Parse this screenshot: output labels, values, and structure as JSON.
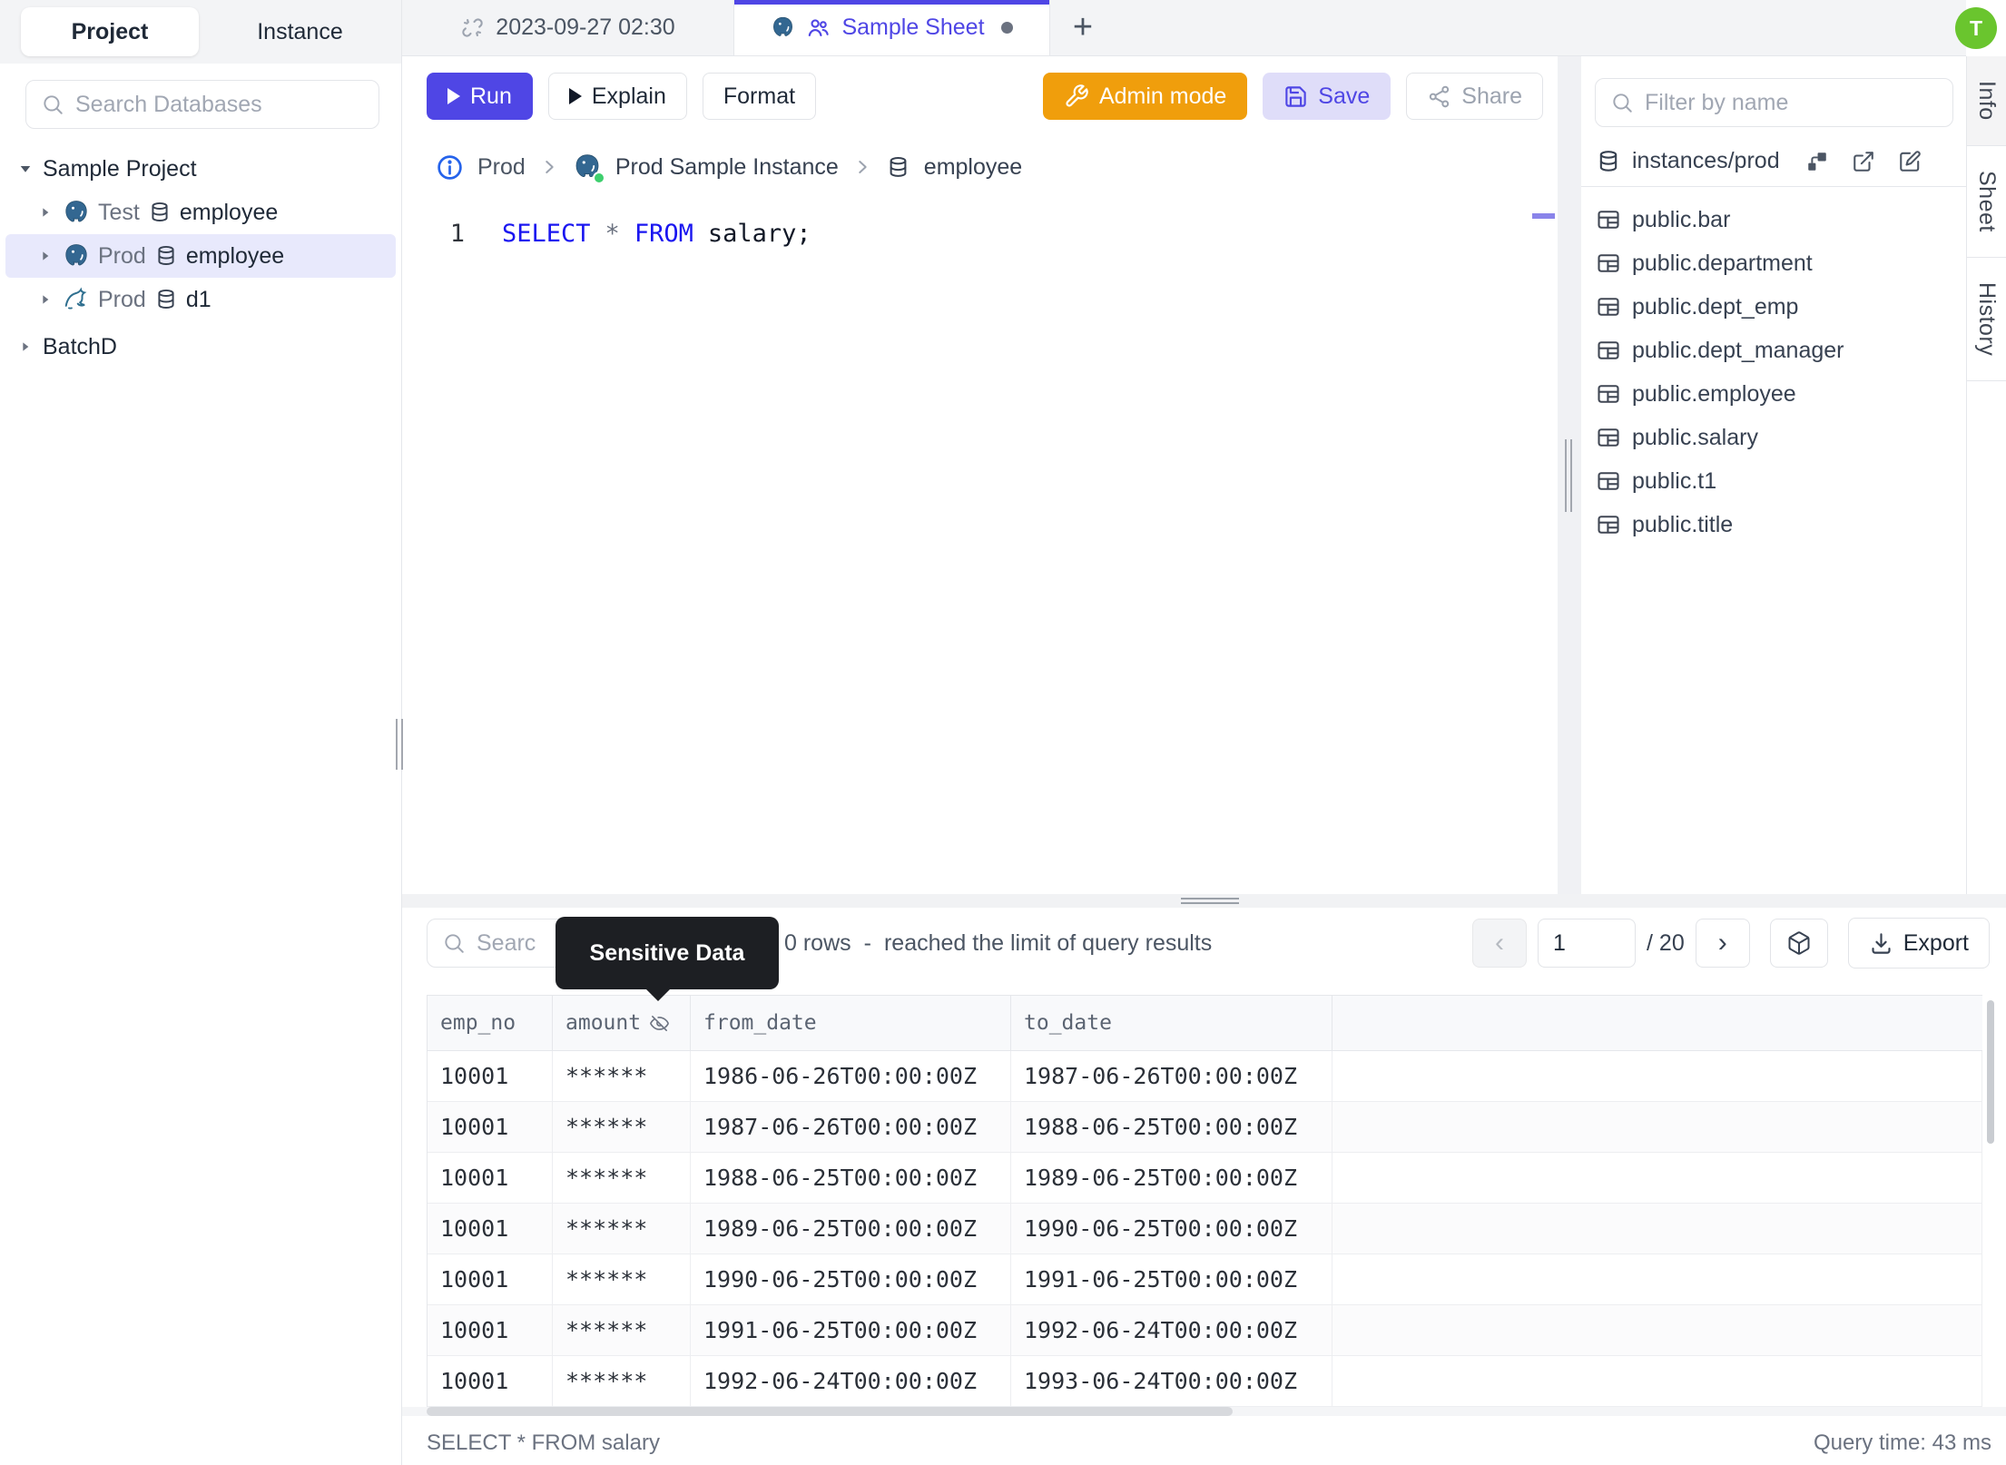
{
  "colors": {
    "accent_indigo": "#4f46e5",
    "admin_orange": "#f09e0c",
    "avatar_green": "#6ac52e",
    "keyword_blue": "#1a16f0",
    "selected_row_bg": "#e8e9fc",
    "tooltip_bg": "#1d1f23",
    "status_dot_green": "#3ecf6e"
  },
  "sidebar": {
    "tab_project": "Project",
    "tab_instance": "Instance",
    "search_placeholder": "Search Databases",
    "tree": {
      "project": "Sample Project",
      "items": [
        {
          "env": "Test",
          "db": "employee",
          "engine": "postgres"
        },
        {
          "env": "Prod",
          "db": "employee",
          "engine": "postgres"
        },
        {
          "env": "Prod",
          "db": "d1",
          "engine": "mysql"
        }
      ],
      "batch": "BatchD"
    }
  },
  "tabbar": {
    "tab1": "2023-09-27 02:30",
    "tab2": "Sample Sheet",
    "new_tab": "+"
  },
  "avatar": {
    "initial": "T"
  },
  "toolbar": {
    "run": "Run",
    "explain": "Explain",
    "format": "Format",
    "admin": "Admin mode",
    "save": "Save",
    "share": "Share"
  },
  "breadcrumb": {
    "env": "Prod",
    "instance": "Prod Sample Instance",
    "database": "employee"
  },
  "editor": {
    "line": "1",
    "kw1": "SELECT",
    "star": "*",
    "kw2": "FROM",
    "tail": "salary;"
  },
  "rightbar": {
    "filter_placeholder": "Filter by name",
    "scope": "instances/prod",
    "tables": [
      "public.bar",
      "public.department",
      "public.dept_emp",
      "public.dept_manager",
      "public.employee",
      "public.salary",
      "public.t1",
      "public.title"
    ]
  },
  "vtabs": {
    "info": "Info",
    "sheet": "Sheet",
    "history": "History"
  },
  "results": {
    "search_placeholder": "Searc",
    "tooltip": "Sensitive Data",
    "rows_count": "0 rows",
    "dash": "-",
    "limit_note": "reached the limit of query results",
    "prev": "‹",
    "next": "›",
    "page_value": "1",
    "page_total": "/ 20",
    "export": "Export",
    "columns": [
      "emp_no",
      "amount",
      "from_date",
      "to_date"
    ],
    "rows": [
      [
        "10001",
        "******",
        "1986-06-26T00:00:00Z",
        "1987-06-26T00:00:00Z"
      ],
      [
        "10001",
        "******",
        "1987-06-26T00:00:00Z",
        "1988-06-25T00:00:00Z"
      ],
      [
        "10001",
        "******",
        "1988-06-25T00:00:00Z",
        "1989-06-25T00:00:00Z"
      ],
      [
        "10001",
        "******",
        "1989-06-25T00:00:00Z",
        "1990-06-25T00:00:00Z"
      ],
      [
        "10001",
        "******",
        "1990-06-25T00:00:00Z",
        "1991-06-25T00:00:00Z"
      ],
      [
        "10001",
        "******",
        "1991-06-25T00:00:00Z",
        "1992-06-24T00:00:00Z"
      ],
      [
        "10001",
        "******",
        "1992-06-24T00:00:00Z",
        "1993-06-24T00:00:00Z"
      ]
    ],
    "statement": "SELECT * FROM salary",
    "query_time": "Query time: 43 ms"
  }
}
